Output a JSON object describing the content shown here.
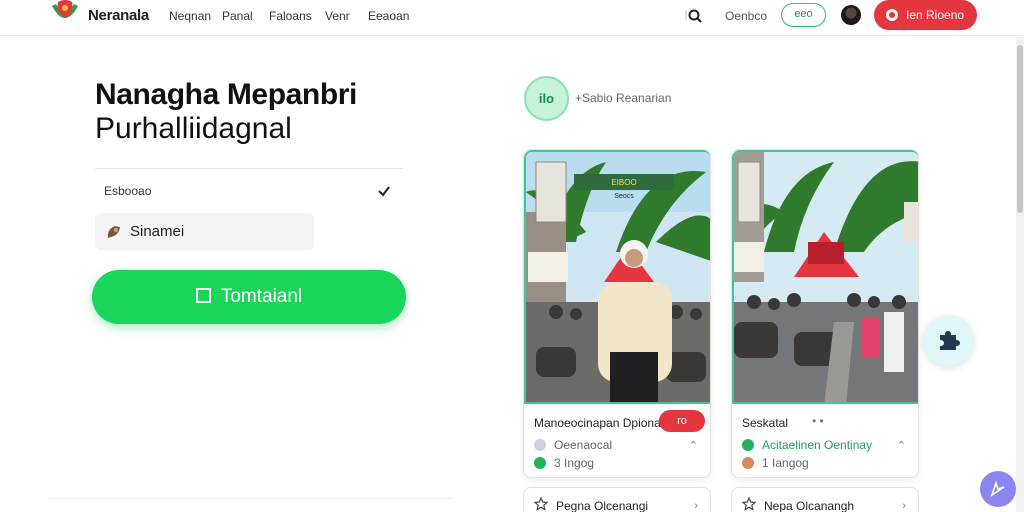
{
  "header": {
    "brand": "Neranala",
    "nav": [
      "Neqnan",
      "Panal",
      "Faloans",
      "Venr",
      "Eeaoan"
    ],
    "link": "Oenbco",
    "outline_btn": "eeo",
    "cta": "Ien Rioeno"
  },
  "hero": {
    "title": "Nanagha Mepanbri",
    "subtitle": "Purhalliidagnal",
    "select_value": "Esbooao",
    "input_value": "Sinamei",
    "primary_btn": "Tomtaianl"
  },
  "right": {
    "badge": "ilo",
    "badge_label": "+Sabio Reanarian",
    "banner_text": "EIBOO",
    "banner_sub": "Seocs"
  },
  "cards": [
    {
      "title": "Manoeocinapan Dpionak",
      "pill": "ro",
      "meta1": "Oeenaocal",
      "meta2": "3 Ingog"
    },
    {
      "title": "Seskatal",
      "dots": "• •",
      "meta1": "Acitaelinen Oentinay",
      "meta2": "1 Iangog"
    }
  ],
  "cards_bottom": [
    {
      "title": "Pegna Olcenangi"
    },
    {
      "title": "Nepa Olcanangh"
    }
  ],
  "colors": {
    "green": "#19d65a",
    "red": "#e3363f",
    "teal": "#3ec79a",
    "purple": "#8b85f0"
  }
}
